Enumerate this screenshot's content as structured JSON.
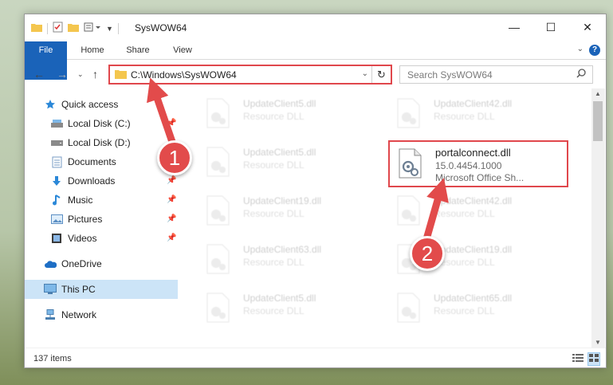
{
  "window": {
    "title": "SysWOW64",
    "controls": {
      "minimize": "—",
      "maximize": "☐",
      "close": "✕"
    }
  },
  "ribbon": {
    "tabs": [
      "File",
      "Home",
      "Share",
      "View"
    ],
    "help": "?"
  },
  "address": {
    "path": "C:\\Windows\\SysWOW64",
    "search_placeholder": "Search SysWOW64"
  },
  "nav": {
    "items": [
      {
        "label": "Quick access",
        "icon": "star-icon",
        "pinned": false
      },
      {
        "label": "Local Disk (C:)",
        "icon": "drive-icon",
        "pinned": true
      },
      {
        "label": "Local Disk (D:)",
        "icon": "drive-icon",
        "pinned": false
      },
      {
        "label": "Documents",
        "icon": "documents-icon",
        "pinned": true
      },
      {
        "label": "Downloads",
        "icon": "download-icon",
        "pinned": true
      },
      {
        "label": "Music",
        "icon": "music-icon",
        "pinned": true
      },
      {
        "label": "Pictures",
        "icon": "pictures-icon",
        "pinned": true
      },
      {
        "label": "Videos",
        "icon": "videos-icon",
        "pinned": true
      },
      {
        "label": "OneDrive",
        "icon": "cloud-icon",
        "pinned": false
      },
      {
        "label": "This PC",
        "icon": "computer-icon",
        "pinned": false,
        "selected": true
      },
      {
        "label": "Network",
        "icon": "network-icon",
        "pinned": false
      }
    ]
  },
  "files": [
    {
      "name": "UpdateClient5.dll",
      "desc": "Resource DLL",
      "faded": true
    },
    {
      "name": "UpdateClient42.dll",
      "desc": "Resource DLL",
      "faded": true
    },
    {
      "name": "UpdateClient5.dll",
      "desc": "Resource DLL",
      "faded": true
    },
    {
      "name": "portalconnect.dll",
      "desc": "15.0.4454.1000",
      "desc2": "Microsoft Office Sh...",
      "faded": false,
      "highlighted": true
    },
    {
      "name": "UpdateClient19.dll",
      "desc": "Resource DLL",
      "faded": true
    },
    {
      "name": "UpdateClient42.dll",
      "desc": "Resource DLL",
      "faded": true
    },
    {
      "name": "UpdateClient63.dll",
      "desc": "Resource DLL",
      "faded": true
    },
    {
      "name": "UpdateClient19.dll",
      "desc": "Resource DLL",
      "faded": true
    },
    {
      "name": "UpdateClient5.dll",
      "desc": "Resource DLL",
      "faded": true
    },
    {
      "name": "UpdateClient65.dll",
      "desc": "Resource DLL",
      "faded": true
    }
  ],
  "status": {
    "item_count": "137 items"
  },
  "annotations": {
    "step1": "1",
    "step2": "2",
    "color": "#e24b4b"
  }
}
